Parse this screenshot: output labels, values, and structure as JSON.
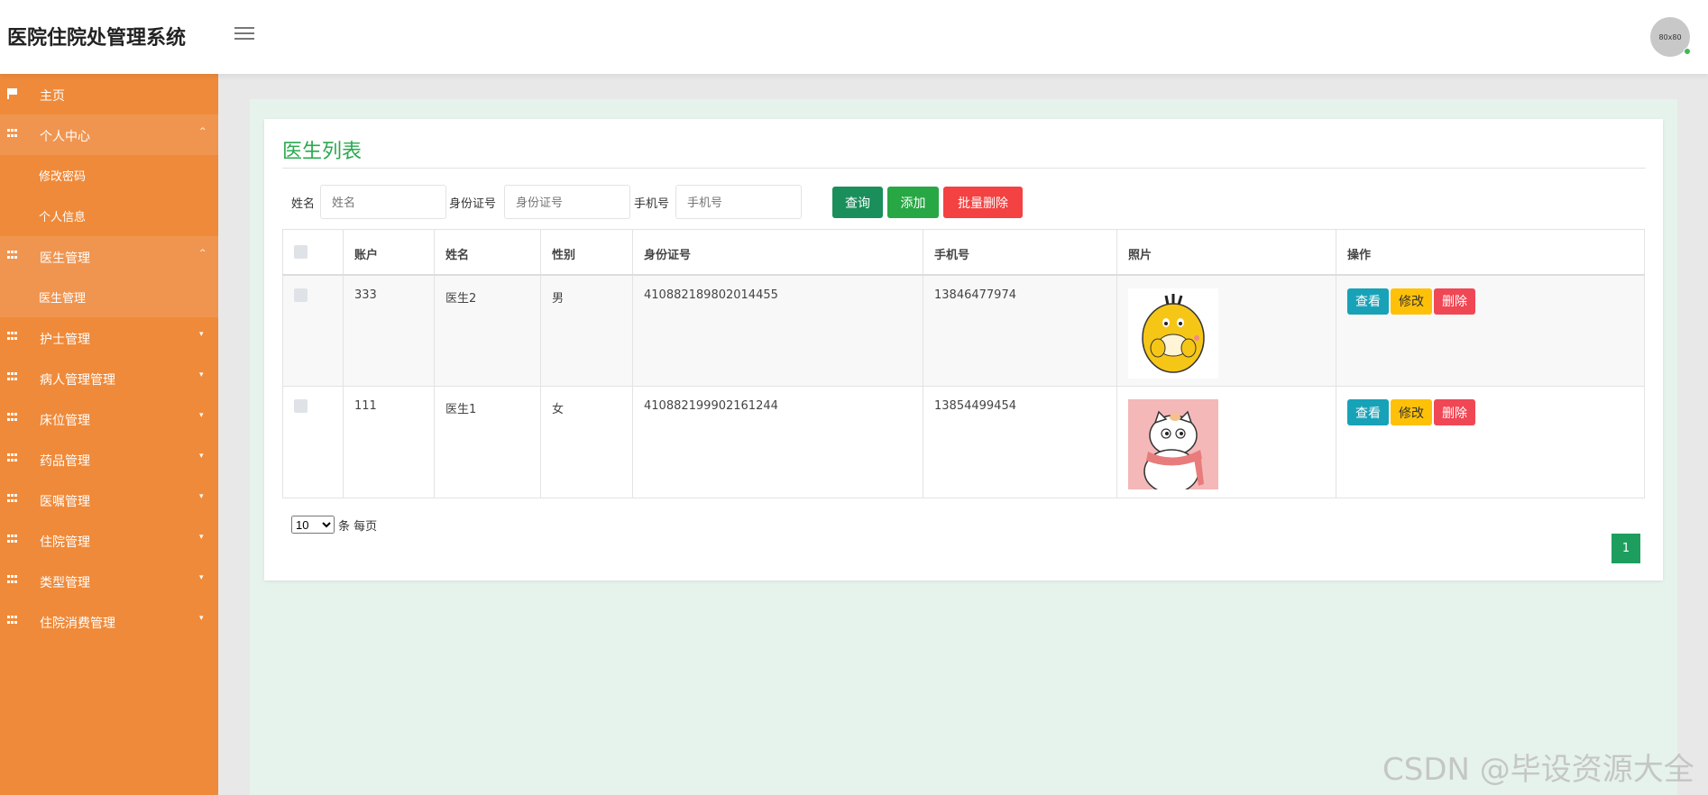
{
  "header": {
    "title": "医院住院处管理系统",
    "avatar_text": "80x80"
  },
  "sidebar": {
    "items": [
      {
        "label": "主页",
        "icon": "flag-icon",
        "caret": ""
      },
      {
        "label": "个人中心",
        "icon": "grid-icon",
        "caret": "^",
        "open": true,
        "children": [
          "修改密码",
          "个人信息"
        ]
      },
      {
        "label": "医生管理",
        "icon": "grid-icon",
        "caret": "^",
        "open": true,
        "children": [
          "医生管理"
        ]
      },
      {
        "label": "护士管理",
        "icon": "grid-icon",
        "caret": "▾"
      },
      {
        "label": "病人管理管理",
        "icon": "grid-icon",
        "caret": "▾"
      },
      {
        "label": "床位管理",
        "icon": "grid-icon",
        "caret": "▾"
      },
      {
        "label": "药品管理",
        "icon": "grid-icon",
        "caret": "▾"
      },
      {
        "label": "医嘱管理",
        "icon": "grid-icon",
        "caret": "▾"
      },
      {
        "label": "住院管理",
        "icon": "grid-icon",
        "caret": "▾"
      },
      {
        "label": "类型管理",
        "icon": "grid-icon",
        "caret": "▾"
      },
      {
        "label": "住院消费管理",
        "icon": "grid-icon",
        "caret": "▾"
      }
    ]
  },
  "main": {
    "title": "医生列表",
    "search": {
      "name_label": "姓名",
      "name_placeholder": "姓名",
      "id_label": "身份证号",
      "id_placeholder": "身份证号",
      "phone_label": "手机号",
      "phone_placeholder": "手机号"
    },
    "buttons": {
      "query": "查询",
      "add": "添加",
      "batch_delete": "批量删除"
    },
    "table": {
      "columns": [
        "账户",
        "姓名",
        "性别",
        "身份证号",
        "手机号",
        "照片",
        "操作"
      ],
      "rows": [
        {
          "account": "333",
          "name": "医生2",
          "gender": "男",
          "id_number": "410882189802014455",
          "phone": "13846477974",
          "photo": "yellow-duck-image"
        },
        {
          "account": "111",
          "name": "医生1",
          "gender": "女",
          "id_number": "410882199902161244",
          "phone": "13854499454",
          "photo": "white-cat-scarf-image"
        }
      ],
      "actions": {
        "view": "查看",
        "edit": "修改",
        "delete": "删除"
      }
    },
    "pagination": {
      "page_size": "10",
      "page_size_options": [
        "10"
      ],
      "per_page_label": "条 每页",
      "current_page": "1"
    }
  },
  "watermark": "CSDN @毕设资源大全",
  "colors": {
    "sidebar": "#ef8a3a",
    "title_green": "#2aa94e",
    "query": "#1a8f5c",
    "add": "#28a745",
    "batch_delete": "#f44141",
    "view": "#17a2b8",
    "edit": "#ffc107",
    "delete": "#f04755"
  }
}
